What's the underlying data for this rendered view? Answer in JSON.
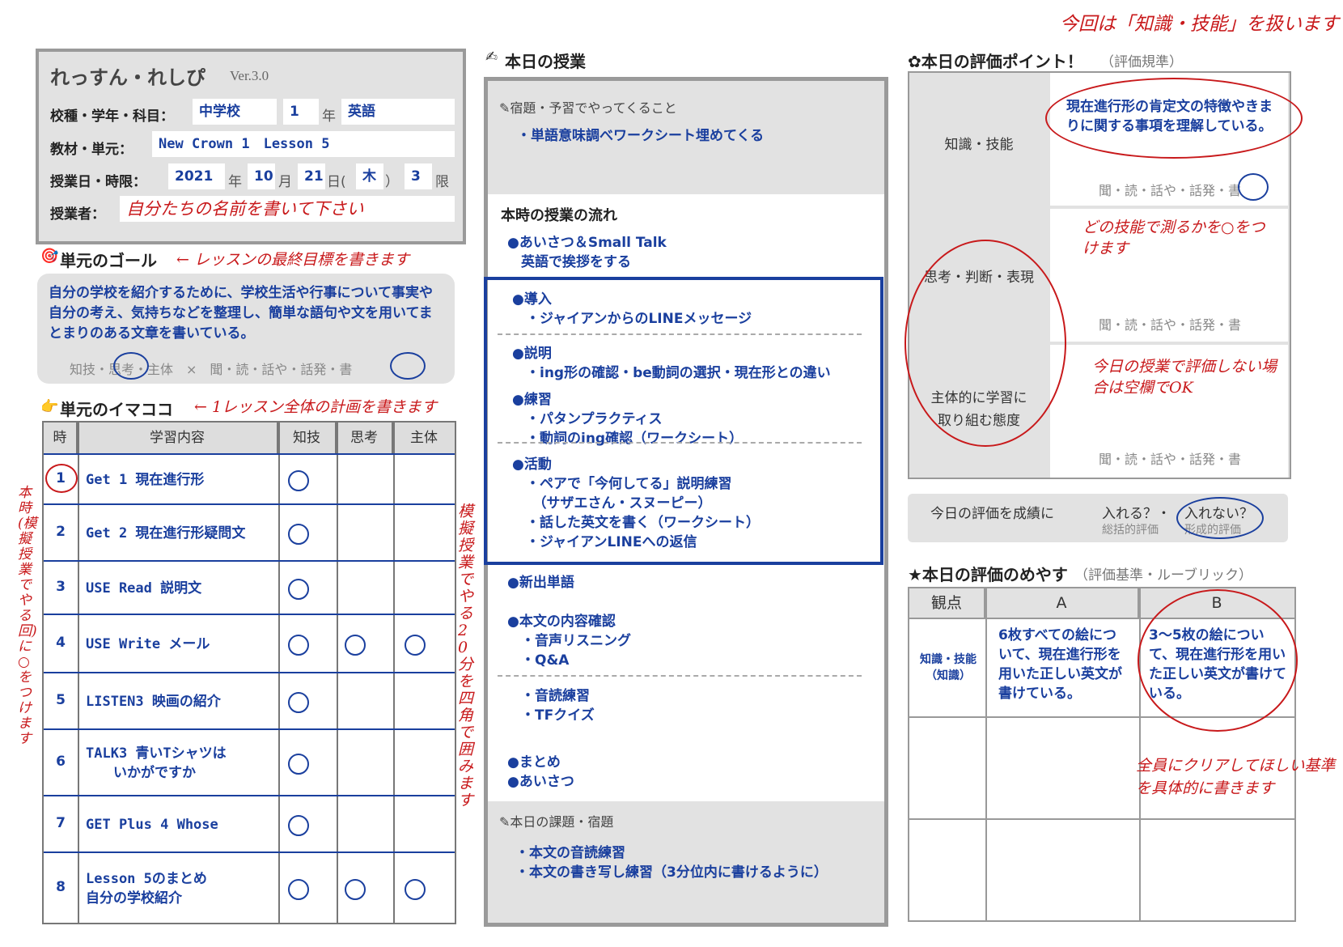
{
  "header": {
    "title": "れっすん・れしぴ",
    "version": "Ver.3.0",
    "school_label": "校種・学年・科目：",
    "school_type": "中学校",
    "grade": "1",
    "grade_unit": "年",
    "subject": "英語",
    "material_label": "教材・単元：",
    "material": "New Crown 1　Lesson 5",
    "date_label": "授業日・時限：",
    "year": "2021",
    "year_unit": "年",
    "month": "10",
    "month_unit": "月",
    "day": "21",
    "day_unit": "日(",
    "weekday": "木",
    "weekday_close": "）",
    "period": "3",
    "period_unit": "限",
    "teacher_label": "授業者：",
    "teacher_note": "自分たちの名前を書いて下さい"
  },
  "goal": {
    "title": "単元のゴール",
    "annotation": "← レッスンの最終目標を書きます",
    "text": "自分の学校を紹介するために、学校生活や行事について事実や自分の考え、気持ちなどを整理し、簡単な語句や文を用いてまとまりのある文章を書いている。",
    "marks": "知技・思考・主体　×　聞・読・話や・話発・書"
  },
  "imamoko": {
    "title": "単元のイマココ",
    "annotation": "← 1レッスン全体の計画を書きます",
    "headers": [
      "時",
      "学習内容",
      "知技",
      "思考",
      "主体"
    ],
    "rows": [
      {
        "num": "1",
        "content": "Get 1 現在進行形",
        "k": true,
        "s": false,
        "m": false
      },
      {
        "num": "2",
        "content": "Get 2 現在進行形疑問文",
        "k": true,
        "s": false,
        "m": false
      },
      {
        "num": "3",
        "content": "USE Read 説明文",
        "k": true,
        "s": false,
        "m": false
      },
      {
        "num": "4",
        "content": "USE Write メール",
        "k": true,
        "s": true,
        "m": true
      },
      {
        "num": "5",
        "content": "LISTEN3 映画の紹介",
        "k": true,
        "s": false,
        "m": false
      },
      {
        "num": "6",
        "content": "TALK3 青いTシャツは\n　　いかがですか",
        "k": true,
        "s": false,
        "m": false
      },
      {
        "num": "7",
        "content": "GET Plus 4 Whose",
        "k": true,
        "s": false,
        "m": false
      },
      {
        "num": "8",
        "content": "Lesson 5のまとめ\n自分の学校紹介",
        "k": true,
        "s": true,
        "m": true
      }
    ],
    "side_note_left": "本時(模擬授業でやる回)に○をつけます",
    "side_note_right": "模擬授業でやる20分を四角で囲みます"
  },
  "lesson": {
    "title": "本日の授業",
    "homework_title": "✎宿題・予習でやってくること",
    "homework_item": "・単語意味調べワークシート埋めてくる",
    "flow_title": "本時の授業の流れ",
    "greeting": "●あいさつ＆Small Talk\n　英語で挨拶をする",
    "intro": "●導入\n　・ジャイアンからのLINEメッセージ",
    "explain": "●説明\n　・ing形の確認・be動詞の選択・現在形との違い",
    "practice": "●練習\n　・パタンプラクティス\n　・動詞のing確認（ワークシート）",
    "activity": "●活動\n　・ペアで「今何してる」説明練習\n　　（サザエさん・スヌーピー）\n　・話した英文を書く（ワークシート）\n　・ジャイアンLINEへの返信",
    "new_words": "●新出単語",
    "content_check": "●本文の内容確認\n　・音声リスニング\n　・Q&A",
    "reading": "　・音読練習\n　・TFクイズ",
    "closing": "●まとめ\n●あいさつ",
    "task_title": "✎本日の課題・宿題",
    "task_items": "・本文の音読練習\n・本文の書き写し練習（3分位内に書けるように）"
  },
  "eval": {
    "top_annotation": "今回は「知識・技能」を扱います",
    "title": "✿本日の評価ポイント！",
    "title_sub": "（評価規準）",
    "rows": [
      {
        "label": "知識・技能",
        "text": "現在進行形の肯定文の特徴やきまりに関する事項を理解している。",
        "marks": "聞・読・話や・話発・書"
      },
      {
        "label": "思考・判断・表現",
        "text": "",
        "marks": "聞・読・話や・話発・書"
      },
      {
        "label": "主体的に学習に\n取り組む態度",
        "text": "",
        "marks": "聞・読・話や・話発・書"
      }
    ],
    "note_skill": "どの技能で測るかを○をつけます",
    "note_blank": "今日の授業で評価しない場合は空欄でOK",
    "grade_question": "今日の評価を成績に",
    "grade_yes": "入れる？・",
    "grade_no": "入れない？",
    "grade_yes_sub": "総括的評価",
    "grade_no_sub": "形成的評価"
  },
  "rubric": {
    "title": "★本日の評価のめやす",
    "title_sub": "（評価基準・ルーブリック）",
    "headers": [
      "観点",
      "A",
      "B"
    ],
    "row_label": "知識・技能\n（知識）",
    "a_text": "6枚すべての絵について、現在進行形を用いた正しい英文が書けている。",
    "b_text": "3〜5枚の絵について、現在進行形を用いた正しい英文が書けている。",
    "note": "全員にクリアしてほしい基準を具体的に書きます"
  },
  "colors": {
    "accent": "#1a3f9e",
    "annotation": "#c8191b",
    "panel": "#e2e2e2"
  }
}
